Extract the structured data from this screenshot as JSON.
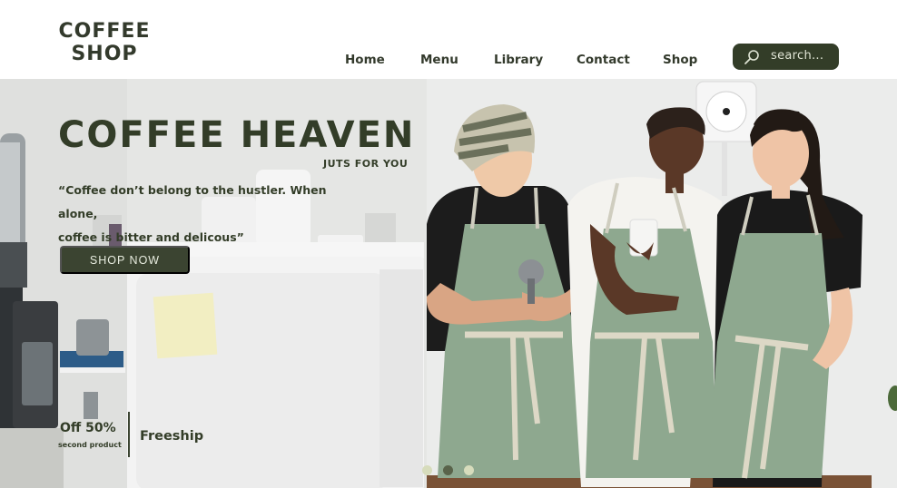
{
  "brand": {
    "line1": "COFFEE",
    "line2": "SHOP"
  },
  "nav": {
    "items": [
      {
        "label": "Home"
      },
      {
        "label": "Menu"
      },
      {
        "label": "Library"
      },
      {
        "label": "Contact"
      },
      {
        "label": "Shop"
      }
    ]
  },
  "search": {
    "placeholder": "search...",
    "icon": "search-icon"
  },
  "hero": {
    "title": "COFFEE HEAVEN",
    "subtitle": "JUTS FOR YOU",
    "quote_line1": "“Coffee don’t belong to the hustler. When alone,",
    "quote_line2": "coffee is bitter and delicous”",
    "cta": "SHOP NOW"
  },
  "promo": {
    "discount": "Off 50%",
    "discount_note": "second product",
    "shipping": "Freeship"
  },
  "carousel": {
    "slides": 3,
    "active_index": 1
  },
  "colors": {
    "brand_dark": "#333d28",
    "button": "#3b4431",
    "apron": "#8ea88f",
    "dot_inactive": "#d7dcbc",
    "dot_active": "#59634a"
  }
}
